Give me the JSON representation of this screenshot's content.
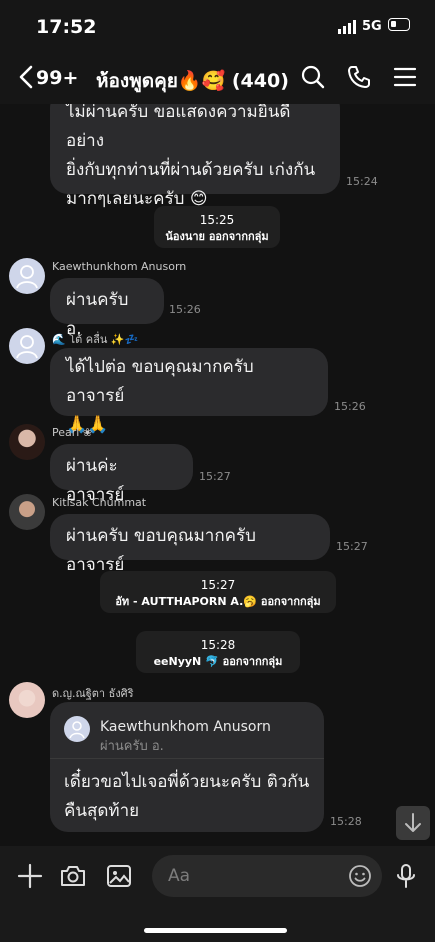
{
  "status_bar": {
    "time": "17:52",
    "network": "5G"
  },
  "header": {
    "unread_count": "99+",
    "title": "ห้องพูดคุย🔥🥰 (440)"
  },
  "messages": {
    "m1": {
      "text": "ไม่ผ่านครับ ขอแสดงความยินดีอย่างยิ่งกับทุกท่านที่ผ่านด้วยครับ เก่งกันมากๆเลยนะครับ 😊",
      "line1": "ไม่ผ่านครับ ขอแสดงความยินดีอย่าง",
      "line2": "ยิ่งกับทุกท่านที่ผ่านด้วยครับ เก่งกัน",
      "line3": "มากๆเลยนะครับ 😊",
      "time": "15:24"
    },
    "sys1": {
      "time": "15:25",
      "text": "น้องนาย ออกจากกลุ่ม"
    },
    "m2": {
      "sender": "Kaewthunkhom Anusorn",
      "text": "ผ่านครับ อ.",
      "time": "15:26"
    },
    "m3": {
      "sender": "🌊 โต้ คลื่น ✨💤",
      "line1": "ได้ไปต่อ ขอบคุณมากครับอาจารย์",
      "line2": "🙏🙏",
      "time": "15:26"
    },
    "m4": {
      "sender": "Pearl ❀",
      "text": "ผ่านค่ะ อาจารย์",
      "time": "15:27"
    },
    "m5": {
      "sender": "Kitisak Chummat",
      "text": "ผ่านครับ ขอบคุณมากครับอาจารย์",
      "time": "15:27"
    },
    "sys2": {
      "time": "15:27",
      "text": "อัท - AUTTHAPORN A.🥱 ออกจากกลุ่ม"
    },
    "sys3": {
      "time": "15:28",
      "text": "eeNyyN 🐬 ออกจากกลุ่ม"
    },
    "m6": {
      "sender": "ด.ญ.ณฐิตา ธังศิริ",
      "reply_name": "Kaewthunkhom Anusorn",
      "reply_text": "ผ่านครับ อ.",
      "line1": "เดี๋ยวขอไปเจอพี่ด้วยนะครับ ติวกัน",
      "line2": "คืนสุดท้าย",
      "time": "15:28"
    }
  },
  "composer": {
    "placeholder": "Aa"
  },
  "icons": [
    "back-chevron-icon",
    "search-icon",
    "phone-icon",
    "menu-icon",
    "plus-icon",
    "camera-icon",
    "image-icon",
    "emoji-icon",
    "microphone-icon",
    "arrow-down-icon"
  ]
}
